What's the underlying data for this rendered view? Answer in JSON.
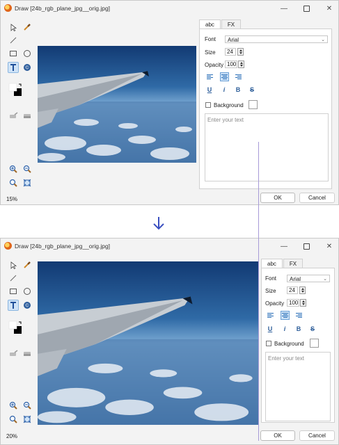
{
  "windows": [
    {
      "title": "Draw [24b_rgb_plane_jpg__orig.jpg]",
      "zoom": "15%",
      "panel": {
        "tabs": [
          "abc",
          "FX"
        ],
        "font_label": "Font",
        "font_value": "Arial",
        "size_label": "Size",
        "size_value": "24",
        "opacity_label": "Opacity",
        "opacity_value": "100",
        "format_buttons": [
          "U",
          "i",
          "B",
          "S"
        ],
        "background_label": "Background",
        "text_placeholder": "Enter your text"
      },
      "buttons": {
        "ok": "OK",
        "cancel": "Cancel"
      }
    },
    {
      "title": "Draw [24b_rgb_plane_jpg__orig.jpg]",
      "zoom": "20%",
      "panel": {
        "tabs": [
          "abc",
          "FX"
        ],
        "font_label": "Font",
        "font_value": "Arial",
        "size_label": "Size",
        "size_value": "24",
        "opacity_label": "Opacity",
        "opacity_value": "100",
        "format_buttons": [
          "U",
          "i",
          "B",
          "S"
        ],
        "background_label": "Background",
        "text_placeholder": "Enter your text"
      },
      "buttons": {
        "ok": "OK",
        "cancel": "Cancel"
      }
    }
  ],
  "colors": {
    "accent": "#2f6fc0",
    "selection": "#cfe3f7",
    "arrow": "#3a4fc0",
    "guide_line": "#a79bd8"
  },
  "icons": [
    "select-arrow-icon",
    "eyedropper-icon",
    "line-icon",
    "rectangle-icon",
    "ellipse-icon",
    "text-icon",
    "stamp-icon",
    "color-swatch-icon",
    "brush-icon",
    "eraser-icon",
    "zoom-in-icon",
    "zoom-out-icon",
    "zoom-search-icon",
    "fit-icon"
  ]
}
